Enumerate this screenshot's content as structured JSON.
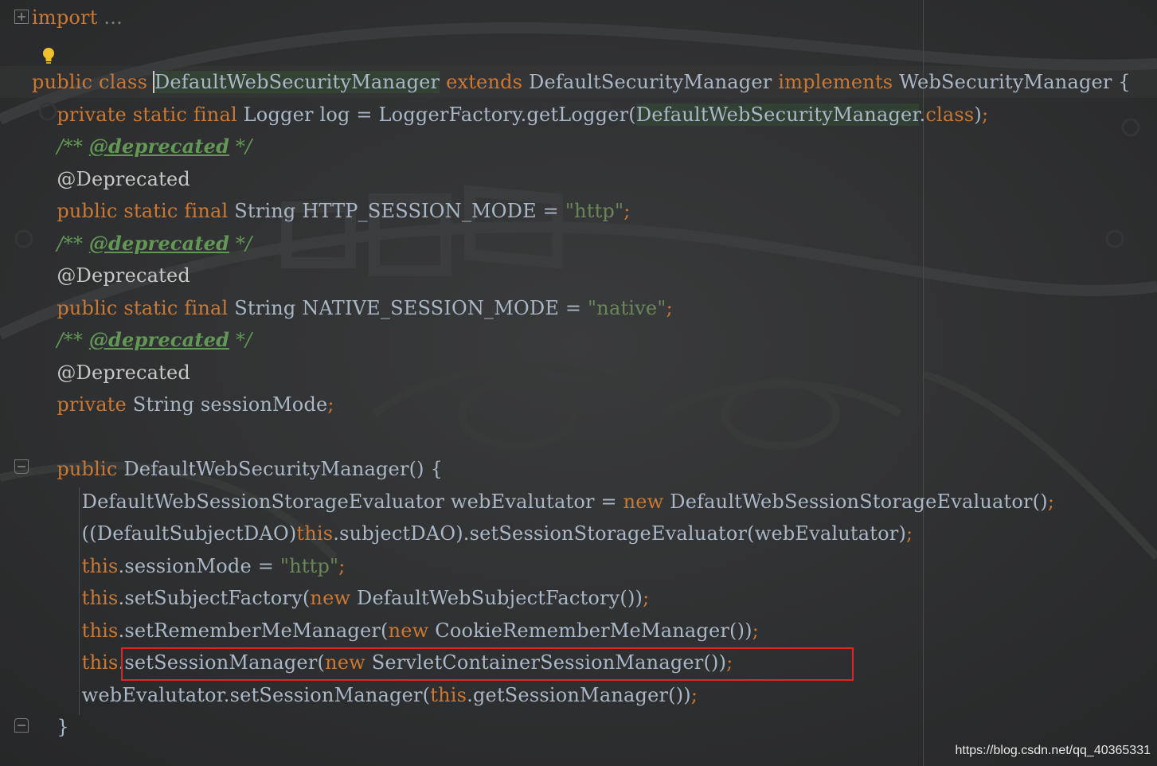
{
  "editor": {
    "language": "java",
    "colors": {
      "background": "#2e2f30",
      "keyword": "#cc7832",
      "identifier": "#a9b7c6",
      "string": "#6a8759",
      "comment": "#629755",
      "highlight_box": "#d62828"
    },
    "lines": [
      {
        "tokens": [
          {
            "t": "import",
            "c": "kw"
          },
          {
            "t": " ",
            "c": "id"
          },
          {
            "t": "...",
            "c": "gray"
          }
        ]
      },
      {
        "tokens": []
      },
      {
        "tokens": [
          {
            "t": "public",
            "c": "kw"
          },
          {
            "t": " ",
            "c": "id"
          },
          {
            "t": "class",
            "c": "kw"
          },
          {
            "t": " ",
            "c": "id"
          },
          {
            "t": "DefaultWebSecurityManager",
            "c": "id ident-hl caret"
          },
          {
            "t": " ",
            "c": "id"
          },
          {
            "t": "extends",
            "c": "kw"
          },
          {
            "t": " DefaultSecurityManager ",
            "c": "id"
          },
          {
            "t": "implements",
            "c": "kw"
          },
          {
            "t": " WebSecurityManager {",
            "c": "id"
          }
        ]
      },
      {
        "tokens": [
          {
            "t": "    ",
            "c": "id"
          },
          {
            "t": "private static final",
            "c": "kw"
          },
          {
            "t": " Logger log = LoggerFactory.getLogger(",
            "c": "id"
          },
          {
            "t": "DefaultWebSecurityManager",
            "c": "id ident-hl"
          },
          {
            "t": ".",
            "c": "id"
          },
          {
            "t": "class",
            "c": "kw"
          },
          {
            "t": ")",
            "c": "id"
          },
          {
            "t": ";",
            "c": "sm"
          }
        ]
      },
      {
        "tokens": [
          {
            "t": "    ",
            "c": "id"
          },
          {
            "t": "/** ",
            "c": "cm"
          },
          {
            "t": "@deprecated",
            "c": "tag"
          },
          {
            "t": " */",
            "c": "cm"
          }
        ]
      },
      {
        "tokens": [
          {
            "t": "    ",
            "c": "id"
          },
          {
            "t": "@Deprecated",
            "c": "an"
          }
        ]
      },
      {
        "tokens": [
          {
            "t": "    ",
            "c": "id"
          },
          {
            "t": "public static final",
            "c": "kw"
          },
          {
            "t": " String HTTP_SESSION_MODE = ",
            "c": "id"
          },
          {
            "t": "\"http\"",
            "c": "st"
          },
          {
            "t": ";",
            "c": "sm"
          }
        ]
      },
      {
        "tokens": [
          {
            "t": "    ",
            "c": "id"
          },
          {
            "t": "/** ",
            "c": "cm"
          },
          {
            "t": "@deprecated",
            "c": "tag"
          },
          {
            "t": " */",
            "c": "cm"
          }
        ]
      },
      {
        "tokens": [
          {
            "t": "    ",
            "c": "id"
          },
          {
            "t": "@Deprecated",
            "c": "an"
          }
        ]
      },
      {
        "tokens": [
          {
            "t": "    ",
            "c": "id"
          },
          {
            "t": "public static final",
            "c": "kw"
          },
          {
            "t": " String NATIVE_SESSION_MODE = ",
            "c": "id"
          },
          {
            "t": "\"native\"",
            "c": "st"
          },
          {
            "t": ";",
            "c": "sm"
          }
        ]
      },
      {
        "tokens": [
          {
            "t": "    ",
            "c": "id"
          },
          {
            "t": "/** ",
            "c": "cm"
          },
          {
            "t": "@deprecated",
            "c": "tag"
          },
          {
            "t": " */",
            "c": "cm"
          }
        ]
      },
      {
        "tokens": [
          {
            "t": "    ",
            "c": "id"
          },
          {
            "t": "@Deprecated",
            "c": "an"
          }
        ]
      },
      {
        "tokens": [
          {
            "t": "    ",
            "c": "id"
          },
          {
            "t": "private",
            "c": "kw"
          },
          {
            "t": " String sessionMode",
            "c": "id"
          },
          {
            "t": ";",
            "c": "sm"
          }
        ]
      },
      {
        "tokens": []
      },
      {
        "tokens": [
          {
            "t": "    ",
            "c": "id"
          },
          {
            "t": "public",
            "c": "kw"
          },
          {
            "t": " DefaultWebSecurityManager() {",
            "c": "id"
          }
        ]
      },
      {
        "tokens": [
          {
            "t": "        DefaultWebSessionStorageEvaluator webEvalutator = ",
            "c": "id"
          },
          {
            "t": "new",
            "c": "kw"
          },
          {
            "t": " DefaultWebSessionStorageEvaluator()",
            "c": "id"
          },
          {
            "t": ";",
            "c": "sm"
          }
        ]
      },
      {
        "tokens": [
          {
            "t": "        ((DefaultSubjectDAO)",
            "c": "id"
          },
          {
            "t": "this",
            "c": "kw"
          },
          {
            "t": ".subjectDAO).setSessionStorageEvaluator(webEvalutator)",
            "c": "id"
          },
          {
            "t": ";",
            "c": "sm"
          }
        ]
      },
      {
        "tokens": [
          {
            "t": "        ",
            "c": "id"
          },
          {
            "t": "this",
            "c": "kw"
          },
          {
            "t": ".sessionMode = ",
            "c": "id"
          },
          {
            "t": "\"http\"",
            "c": "st"
          },
          {
            "t": ";",
            "c": "sm"
          }
        ]
      },
      {
        "tokens": [
          {
            "t": "        ",
            "c": "id"
          },
          {
            "t": "this",
            "c": "kw"
          },
          {
            "t": ".setSubjectFactory(",
            "c": "id"
          },
          {
            "t": "new",
            "c": "kw"
          },
          {
            "t": " DefaultWebSubjectFactory())",
            "c": "id"
          },
          {
            "t": ";",
            "c": "sm"
          }
        ]
      },
      {
        "tokens": [
          {
            "t": "        ",
            "c": "id"
          },
          {
            "t": "this",
            "c": "kw"
          },
          {
            "t": ".setRememberMeManager(",
            "c": "id"
          },
          {
            "t": "new",
            "c": "kw"
          },
          {
            "t": " CookieRememberMeManager())",
            "c": "id"
          },
          {
            "t": ";",
            "c": "sm"
          }
        ]
      },
      {
        "tokens": [
          {
            "t": "        ",
            "c": "id"
          },
          {
            "t": "this",
            "c": "kw"
          },
          {
            "t": ".setSessionManager(",
            "c": "id"
          },
          {
            "t": "new",
            "c": "kw"
          },
          {
            "t": " ServletContainerSessionManager())",
            "c": "id"
          },
          {
            "t": ";",
            "c": "sm"
          }
        ]
      },
      {
        "tokens": [
          {
            "t": "        webEvalutator.setSessionManager(",
            "c": "id"
          },
          {
            "t": "this",
            "c": "kw"
          },
          {
            "t": ".getSessionManager())",
            "c": "id"
          },
          {
            "t": ";",
            "c": "sm"
          }
        ]
      },
      {
        "tokens": [
          {
            "t": "    }",
            "c": "id"
          }
        ]
      }
    ]
  },
  "watermark": "https://blog.csdn.net/qq_40365331"
}
